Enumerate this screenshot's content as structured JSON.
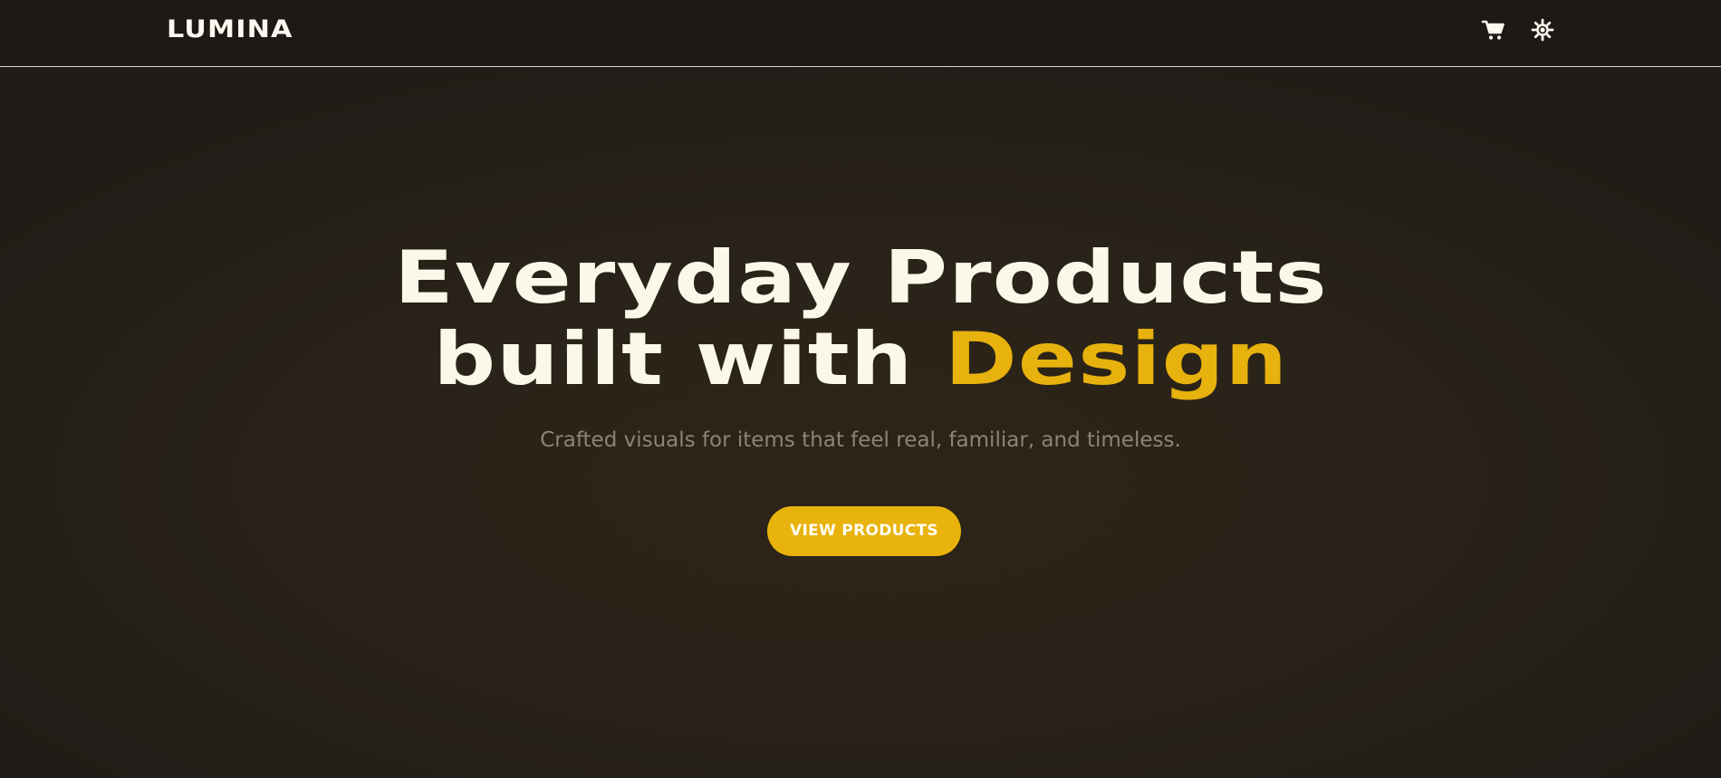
{
  "navbar": {
    "logo": "LUMINA",
    "cart_icon": "shopping-cart-icon",
    "theme_icon": "sun-icon"
  },
  "hero": {
    "headline_line1": "Everyday Products",
    "headline_line2_prefix": "built with",
    "headline_line2_accent": "Design",
    "subtitle": "Crafted visuals for items that feel real, familiar, and timeless.",
    "cta_label": "VIEW PRODUCTS"
  },
  "colors": {
    "background": "#1e1a16",
    "accent": "#e7b10e",
    "headline_text": "#fbf8ea",
    "subtitle_text": "#8c847a",
    "cta_text": "#fffdf3"
  }
}
